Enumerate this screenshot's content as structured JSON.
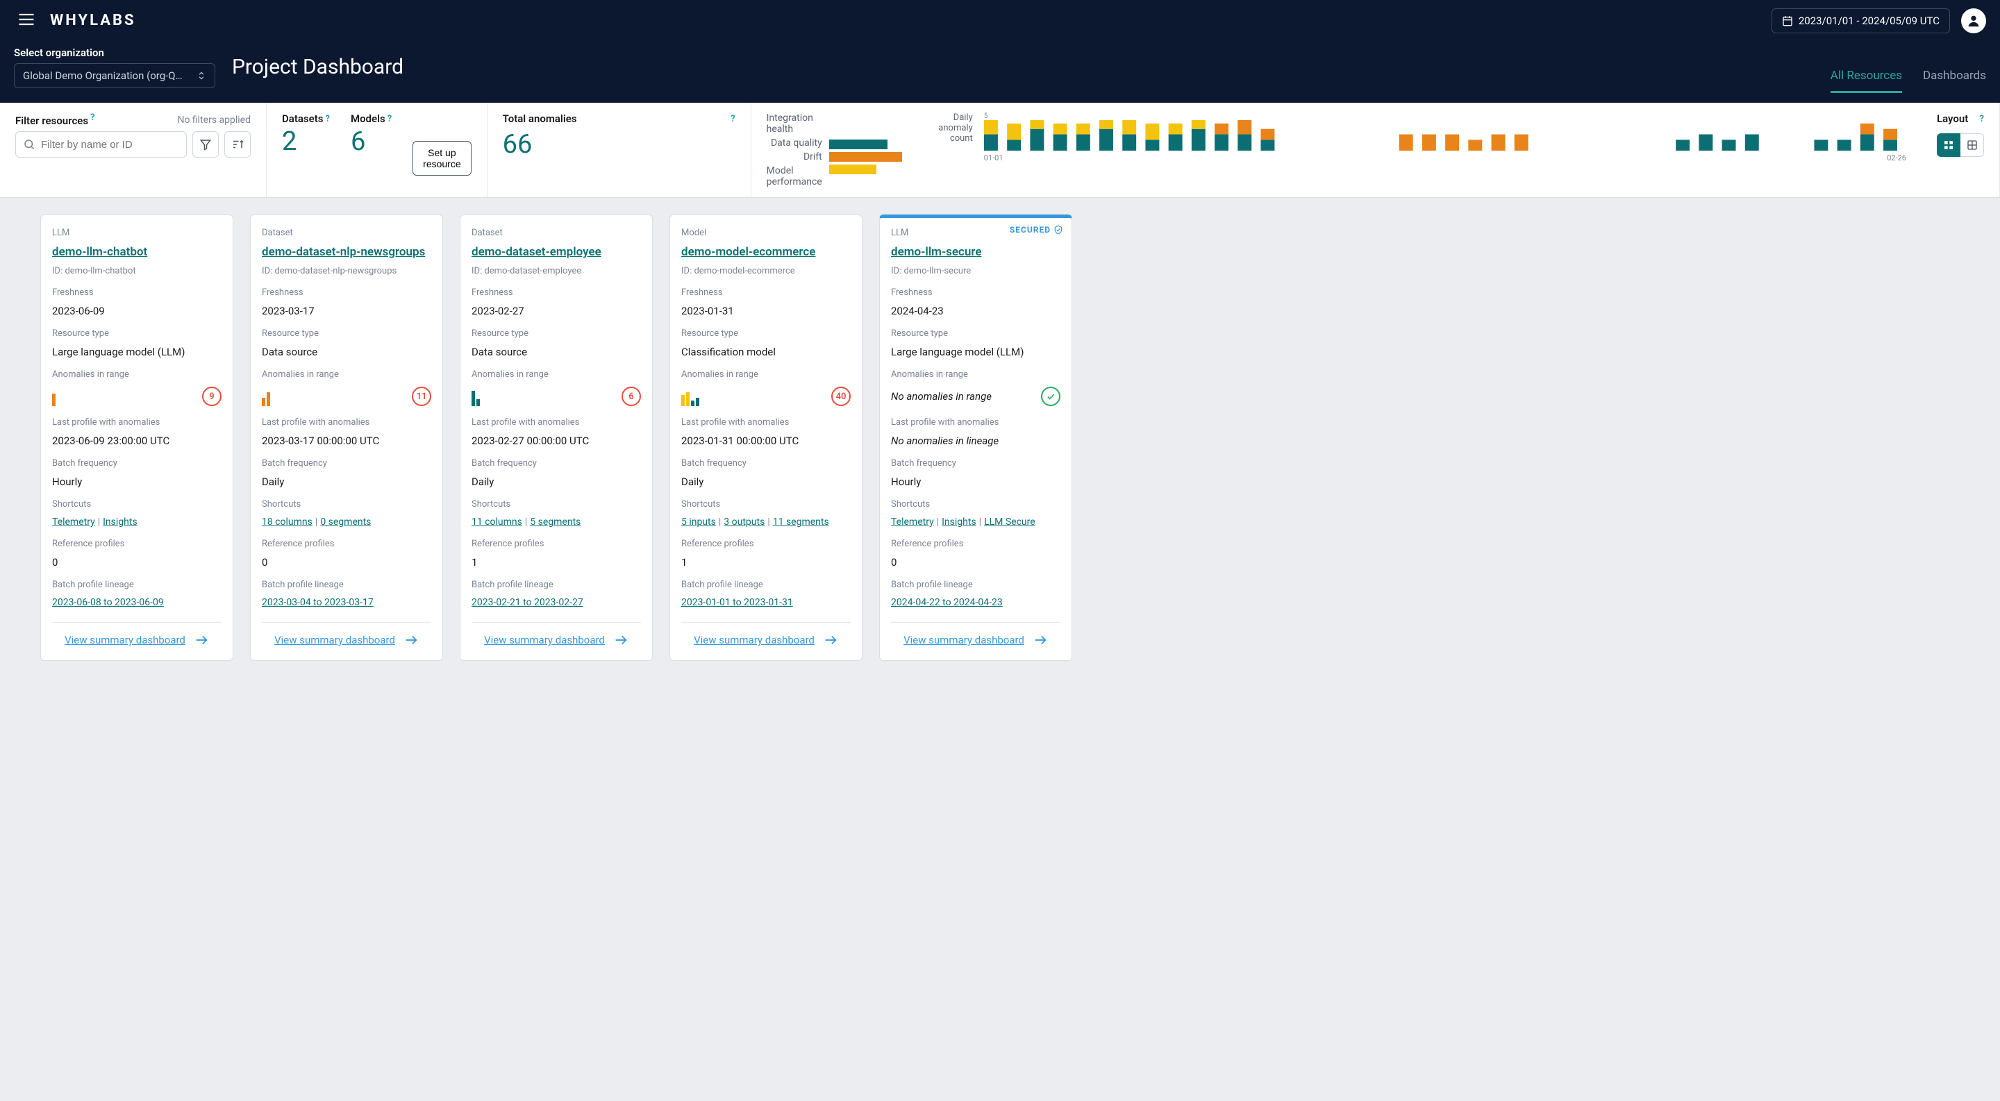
{
  "header": {
    "logo": "WHYLABS",
    "date_range": "2023/01/01  -  2024/05/09 UTC",
    "org_label": "Select organization",
    "org_selected": "Global Demo Organization (org-Q…",
    "page_title": "Project Dashboard",
    "tabs": {
      "all_resources": "All Resources",
      "dashboards": "Dashboards"
    }
  },
  "filter": {
    "label": "Filter resources",
    "status": "No filters applied",
    "placeholder": "Filter by name or ID"
  },
  "counts": {
    "datasets_label": "Datasets",
    "datasets": "2",
    "models_label": "Models",
    "models": "6",
    "setup": "Set up resource"
  },
  "anomalies": {
    "label": "Total anomalies",
    "value": "66"
  },
  "health": {
    "integration": "Integration health",
    "quality": "Data quality",
    "drift": "Drift",
    "perf": "Model performance"
  },
  "daily": {
    "label1": "Daily",
    "label2": "anomaly",
    "label3": "count",
    "tick1": "01-01",
    "tick2": "02-26",
    "ytick": "5"
  },
  "layout": {
    "label": "Layout"
  },
  "cards": [
    {
      "category": "LLM",
      "name": "demo-llm-chatbot",
      "id": "ID: demo-llm-chatbot",
      "freshness_label": "Freshness",
      "freshness": "2023-06-09",
      "type_label": "Resource type",
      "type": "Large language model (LLM)",
      "anom_label": "Anomalies in range",
      "anom_count": "9",
      "last_label": "Last profile with anomalies",
      "last": "2023-06-09 23:00:00 UTC",
      "freq_label": "Batch frequency",
      "freq": "Hourly",
      "shortcuts_label": "Shortcuts",
      "s1": "Telemetry",
      "s2": "Insights",
      "s3": "",
      "ref_label": "Reference profiles",
      "ref": "0",
      "lineage_label": "Batch profile lineage",
      "lineage": "2023-06-08 to 2023-06-09",
      "view": "View summary dashboard"
    },
    {
      "category": "Dataset",
      "name": "demo-dataset-nlp-newsgroups",
      "id": "ID: demo-dataset-nlp-newsgroups",
      "freshness_label": "Freshness",
      "freshness": "2023-03-17",
      "type_label": "Resource type",
      "type": "Data source",
      "anom_label": "Anomalies in range",
      "anom_count": "11",
      "last_label": "Last profile with anomalies",
      "last": "2023-03-17 00:00:00 UTC",
      "freq_label": "Batch frequency",
      "freq": "Daily",
      "shortcuts_label": "Shortcuts",
      "s1": "18 columns",
      "s2": "0 segments",
      "s3": "",
      "ref_label": "Reference profiles",
      "ref": "0",
      "lineage_label": "Batch profile lineage",
      "lineage": "2023-03-04 to 2023-03-17",
      "view": "View summary dashboard"
    },
    {
      "category": "Dataset",
      "name": "demo-dataset-employee",
      "id": "ID: demo-dataset-employee",
      "freshness_label": "Freshness",
      "freshness": "2023-02-27",
      "type_label": "Resource type",
      "type": "Data source",
      "anom_label": "Anomalies in range",
      "anom_count": "6",
      "last_label": "Last profile with anomalies",
      "last": "2023-02-27 00:00:00 UTC",
      "freq_label": "Batch frequency",
      "freq": "Daily",
      "shortcuts_label": "Shortcuts",
      "s1": "11 columns",
      "s2": "5 segments",
      "s3": "",
      "ref_label": "Reference profiles",
      "ref": "1",
      "lineage_label": "Batch profile lineage",
      "lineage": "2023-02-21 to 2023-02-27",
      "view": "View summary dashboard"
    },
    {
      "category": "Model",
      "name": "demo-model-ecommerce",
      "id": "ID: demo-model-ecommerce",
      "freshness_label": "Freshness",
      "freshness": "2023-01-31",
      "type_label": "Resource type",
      "type": "Classification model",
      "anom_label": "Anomalies in range",
      "anom_count": "40",
      "last_label": "Last profile with anomalies",
      "last": "2023-01-31 00:00:00 UTC",
      "freq_label": "Batch frequency",
      "freq": "Daily",
      "shortcuts_label": "Shortcuts",
      "s1": "5 inputs",
      "s2": "3 outputs",
      "s3": "11 segments",
      "ref_label": "Reference profiles",
      "ref": "1",
      "lineage_label": "Batch profile lineage",
      "lineage": "2023-01-01 to 2023-01-31",
      "view": "View summary dashboard"
    },
    {
      "category": "LLM",
      "secured": "SECURED",
      "name": "demo-llm-secure",
      "id": "ID: demo-llm-secure",
      "freshness_label": "Freshness",
      "freshness": "2024-04-23",
      "type_label": "Resource type",
      "type": "Large language model (LLM)",
      "anom_label": "Anomalies in range",
      "anom_text": "No anomalies in range",
      "last_label": "Last profile with anomalies",
      "last_italic": "No anomalies in lineage",
      "freq_label": "Batch frequency",
      "freq": "Hourly",
      "shortcuts_label": "Shortcuts",
      "s1": "Telemetry",
      "s2": "Insights",
      "s3": "LLM Secure",
      "ref_label": "Reference profiles",
      "ref": "0",
      "lineage_label": "Batch profile lineage",
      "lineage": "2024-04-22 to 2024-04-23",
      "view": "View summary dashboard"
    }
  ],
  "chart_data": {
    "health_bars": {
      "type": "bar",
      "categories": [
        "Integration health",
        "Data quality",
        "Drift",
        "Model performance"
      ],
      "values": [
        0,
        80,
        100,
        65
      ],
      "colors": [
        "#0b6e73",
        "#0b6e73",
        "#e8841a",
        "#f3c40f"
      ]
    },
    "daily_anomaly": {
      "type": "bar",
      "ylim": [
        0,
        5
      ],
      "xrange": [
        "01-01",
        "02-26"
      ],
      "title": "Daily anomaly count",
      "series": [
        {
          "name": "Data quality",
          "color": "#0b6e73",
          "values": [
            3,
            2,
            4,
            3,
            3,
            4,
            3,
            2,
            3,
            4,
            3,
            3,
            2,
            0,
            0,
            0,
            0,
            0,
            0,
            0,
            0,
            0,
            0,
            0,
            0,
            0,
            0,
            0,
            0,
            0,
            2,
            3,
            2,
            3,
            0,
            0,
            2,
            2,
            3,
            2
          ]
        },
        {
          "name": "Drift",
          "color": "#e8841a",
          "values": [
            0,
            0,
            0,
            0,
            0,
            0,
            0,
            0,
            0,
            0,
            2,
            3,
            2,
            0,
            0,
            0,
            0,
            0,
            3,
            3,
            3,
            2,
            3,
            3,
            0,
            0,
            0,
            0,
            0,
            0,
            0,
            0,
            0,
            0,
            0,
            0,
            0,
            0,
            2,
            2
          ]
        },
        {
          "name": "Model performance",
          "color": "#f3c40f",
          "values": [
            3,
            3,
            2,
            2,
            2,
            3,
            3,
            3,
            2,
            2,
            0,
            0,
            0,
            0,
            0,
            0,
            0,
            0,
            0,
            0,
            0,
            0,
            0,
            0,
            0,
            0,
            0,
            0,
            0,
            0,
            0,
            0,
            0,
            0,
            0,
            0,
            0,
            0,
            0,
            0
          ]
        }
      ]
    }
  }
}
